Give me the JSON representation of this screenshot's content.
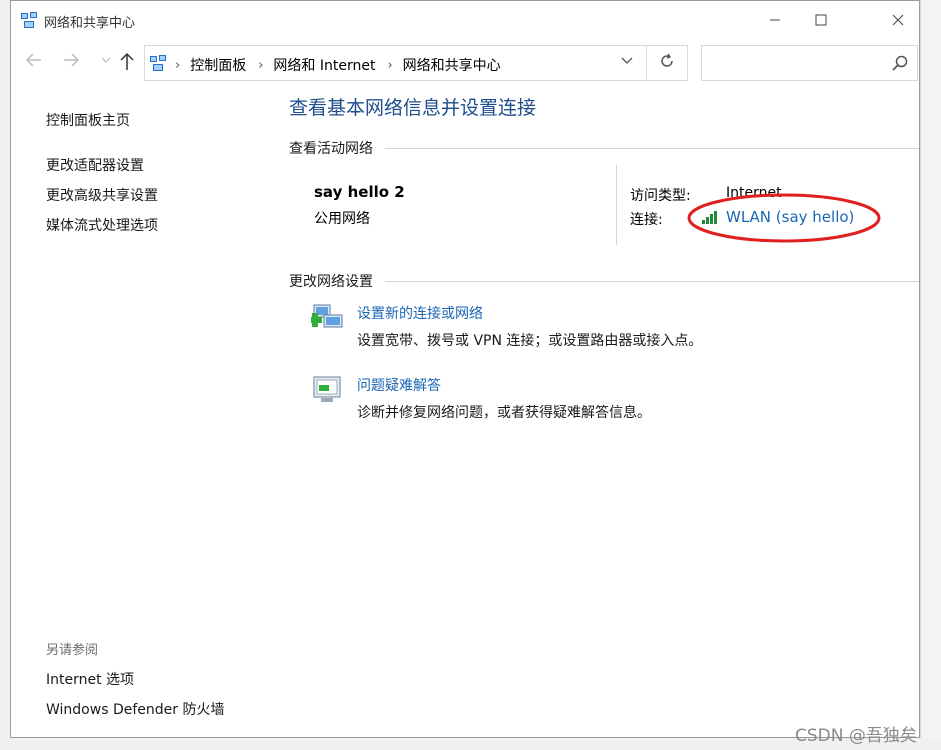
{
  "window": {
    "title": "网络和共享中心"
  },
  "address_bar": {
    "crumbs": [
      "控制面板",
      "网络和 Internet",
      "网络和共享中心"
    ],
    "search_placeholder": ""
  },
  "sidebar": {
    "home": "控制面板主页",
    "items": [
      "更改适配器设置",
      "更改高级共享设置",
      "媒体流式处理选项"
    ],
    "see_also_heading": "另请参阅",
    "see_also": [
      "Internet 选项",
      "Windows Defender 防火墙"
    ]
  },
  "main": {
    "title": "查看基本网络信息并设置连接",
    "active_heading": "查看活动网络",
    "network": {
      "name": "say hello 2",
      "type": "公用网络",
      "access_label": "访问类型:",
      "access_value": "Internet",
      "connection_label": "连接:",
      "connection_value": "WLAN (say hello)"
    },
    "change_heading": "更改网络设置",
    "tasks": [
      {
        "link": "设置新的连接或网络",
        "desc": "设置宽带、拨号或 VPN 连接；或设置路由器或接入点。",
        "icon": "network-setup-icon"
      },
      {
        "link": "问题疑难解答",
        "desc": "诊断并修复网络问题，或者获得疑难解答信息。",
        "icon": "troubleshoot-icon"
      }
    ]
  },
  "watermark": "CSDN @吾独矣",
  "colors": {
    "link": "#1a66b5",
    "title": "#1e4e8c",
    "annotation": "#e02020"
  }
}
